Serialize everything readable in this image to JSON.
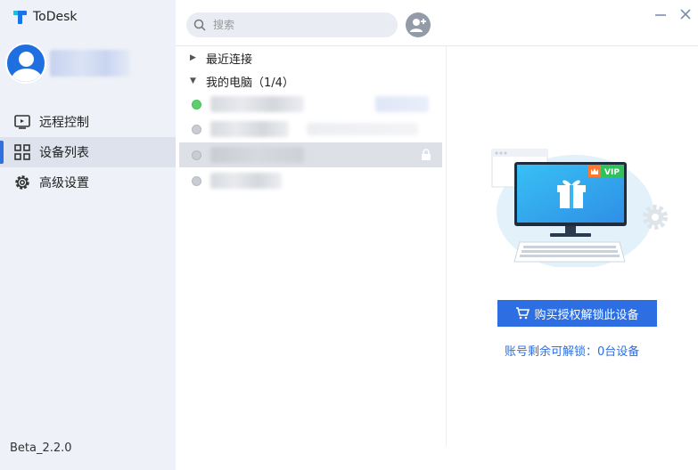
{
  "app": {
    "title": "ToDesk",
    "version": "Beta_2.2.0"
  },
  "nav": {
    "items": [
      {
        "label": "远程控制",
        "icon": "remote-control-icon",
        "active": false
      },
      {
        "label": "设备列表",
        "icon": "grid-icon",
        "active": true
      },
      {
        "label": "高级设置",
        "icon": "gear-icon",
        "active": false
      }
    ]
  },
  "search": {
    "placeholder": "搜索",
    "value": ""
  },
  "groups": {
    "recent": {
      "label": "最近连接",
      "expanded": false
    },
    "mine": {
      "label": "我的电脑（1/4）",
      "expanded": true
    }
  },
  "devices": [
    {
      "status": "online",
      "selected": false,
      "locked": false
    },
    {
      "status": "offline",
      "selected": false,
      "locked": false
    },
    {
      "status": "offline",
      "selected": true,
      "locked": true
    },
    {
      "status": "offline",
      "selected": false,
      "locked": false
    }
  ],
  "promo": {
    "badge": "VIP",
    "button_label": "购买授权解锁此设备",
    "quota_text": "账号剩余可解锁：0台设备"
  },
  "colors": {
    "accent": "#2d6fe2",
    "sidebar_bg": "#eef1f7",
    "vip_green": "#2fc25b"
  }
}
